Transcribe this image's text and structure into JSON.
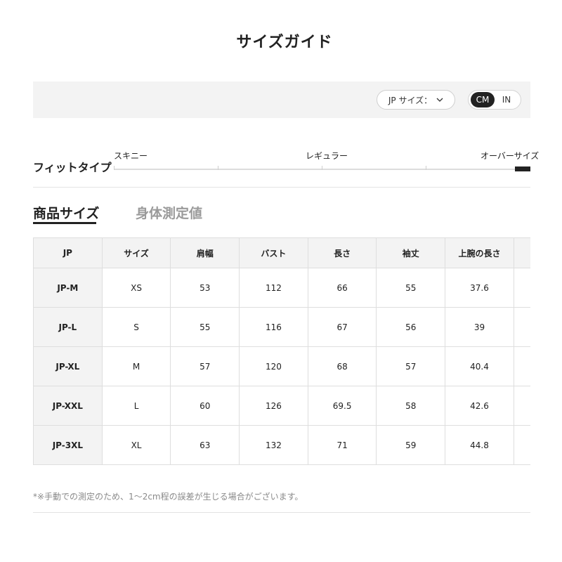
{
  "page_title": "サイズガイド",
  "controls": {
    "jp_select_label": "JP サイズ：",
    "units": [
      "CM",
      "IN"
    ],
    "active_unit": "CM"
  },
  "fit": {
    "label": "フィットタイプ",
    "options": [
      "スキニー",
      "レギュラー",
      "オーバーサイズ"
    ],
    "selected": "オーバーサイズ"
  },
  "tabs": [
    {
      "label": "商品サイズ",
      "active": true
    },
    {
      "label": "身体測定値",
      "active": false
    }
  ],
  "table": {
    "headers": [
      "JP",
      "サイズ",
      "肩幅",
      "バスト",
      "長さ",
      "袖丈",
      "上腕の長さ",
      ""
    ],
    "rows": [
      [
        "JP-M",
        "XS",
        "53",
        "112",
        "66",
        "55",
        "37.6",
        ""
      ],
      [
        "JP-L",
        "S",
        "55",
        "116",
        "67",
        "56",
        "39",
        ""
      ],
      [
        "JP-XL",
        "M",
        "57",
        "120",
        "68",
        "57",
        "40.4",
        ""
      ],
      [
        "JP-XXL",
        "L",
        "60",
        "126",
        "69.5",
        "58",
        "42.6",
        ""
      ],
      [
        "JP-3XL",
        "XL",
        "63",
        "132",
        "71",
        "59",
        "44.8",
        ""
      ]
    ]
  },
  "note": "*※手動での測定のため、1〜2cm程の誤差が生じる場合がございます。"
}
